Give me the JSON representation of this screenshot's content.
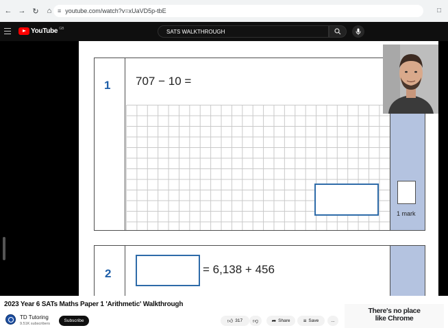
{
  "browser": {
    "url": "youtube.com/watch?v=xUaVD5p-tbE"
  },
  "youtube": {
    "logo_text": "YouTube",
    "country_code": "GB",
    "search_value": "SATS WALKTHROUGH"
  },
  "worksheet": {
    "q1_number": "1",
    "q1_expression": "707 − 10 =",
    "mark_label": "1 mark",
    "q2_number": "2",
    "q2_expression": "= 6,138 + 456"
  },
  "video": {
    "title": "2023 Year 6 SATs Maths Paper 1 'Arithmetic' Walkthrough",
    "channel_name": "TD Tutoring",
    "subscribers": "9.51K subscribers",
    "subscribe_label": "Subscribe",
    "like_count": "317",
    "share_label": "Share",
    "save_label": "Save",
    "more_label": "..."
  },
  "ad": {
    "line1": "There's no place",
    "line2": "like Chrome"
  },
  "icons": {
    "back": "back-arrow-icon",
    "forward": "forward-arrow-icon",
    "reload": "reload-icon",
    "home": "home-icon",
    "search": "search-icon",
    "mic": "microphone-icon"
  }
}
